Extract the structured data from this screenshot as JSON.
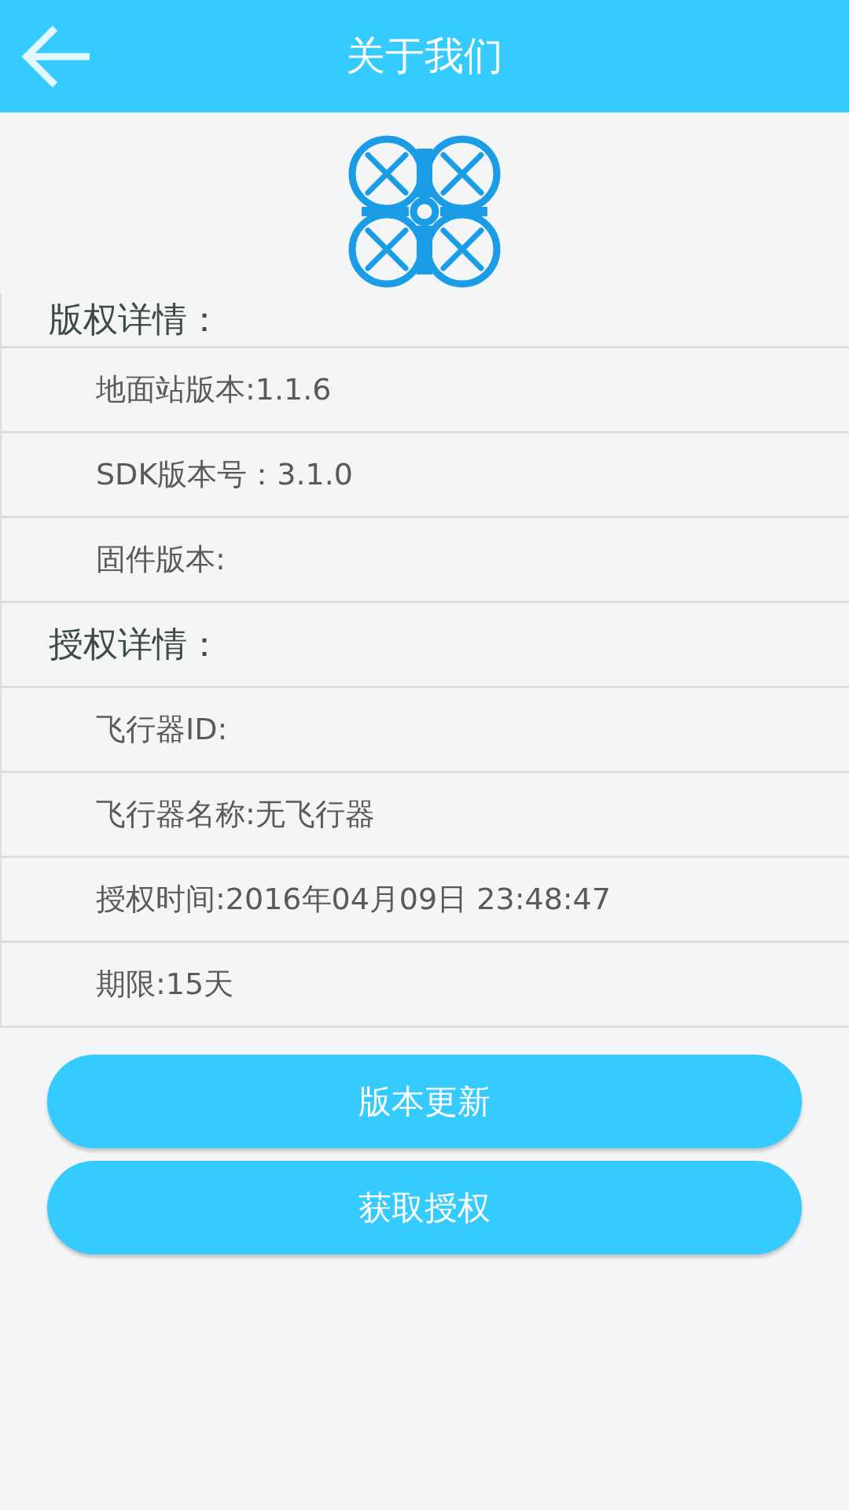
{
  "header": {
    "title": "关于我们"
  },
  "rows": [
    {
      "kind": "heading",
      "text": "版权详情："
    },
    {
      "kind": "item",
      "text": "地面站版本:1.1.6"
    },
    {
      "kind": "item",
      "text": "SDK版本号：3.1.0"
    },
    {
      "kind": "item",
      "text": "固件版本:"
    },
    {
      "kind": "heading",
      "text": "授权详情："
    },
    {
      "kind": "item",
      "text": "飞行器ID:"
    },
    {
      "kind": "item",
      "text": "飞行器名称:无飞行器"
    },
    {
      "kind": "item",
      "text": "授权时间:2016年04月09日 23:48:47"
    },
    {
      "kind": "item",
      "text": "期限:15天"
    }
  ],
  "buttons": [
    "版本更新",
    "获取授权"
  ]
}
